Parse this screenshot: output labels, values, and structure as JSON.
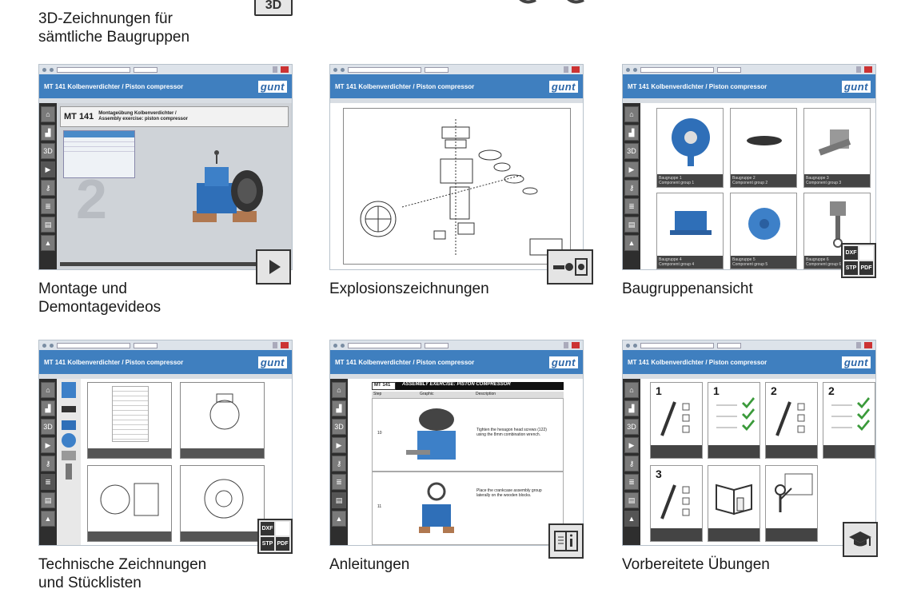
{
  "top": {
    "caption_line1": "3D-Zeichnungen für",
    "caption_line2": "sämtliche Baugruppen",
    "badge_label": "3D"
  },
  "app": {
    "title": "MT 141 Kolbenverdichter / Piston compressor",
    "logo": "gunt"
  },
  "sidebar_icons": [
    "home-icon",
    "compressor-icon",
    "3d-icon",
    "play-icon",
    "key-icon",
    "document-icon",
    "document-info-icon",
    "graduation-cap-icon"
  ],
  "sidebar_3d_label": "3D",
  "tiles": [
    {
      "caption_line1": "Montage und",
      "caption_line2": "Demontagevideos",
      "badge": "play-icon"
    },
    {
      "caption_line1": "Explosionszeichnungen",
      "caption_line2": "",
      "badge": "exploded-view-icon"
    },
    {
      "caption_line1": "Baugruppenansicht",
      "caption_line2": "",
      "badge": "file-format-icon"
    },
    {
      "caption_line1": "Technische Zeichnungen",
      "caption_line2": "und Stücklisten",
      "badge": "file-format-icon"
    },
    {
      "caption_line1": "Anleitungen",
      "caption_line2": "",
      "badge": "manual-icon"
    },
    {
      "caption_line1": "Vorbereitete Übungen",
      "caption_line2": "",
      "badge": "graduation-cap-icon"
    }
  ],
  "video": {
    "title_line1": "Montageübung Kolbenverdichter /",
    "title_line2": "Assembly exercise: piston compressor",
    "code": "MT 141",
    "big_number": "2"
  },
  "formats": {
    "dxf": "DXF",
    "stp": "STP",
    "pdf": "PDF"
  },
  "assembly_groups": [
    {
      "de": "Baugruppe 1",
      "en": "Component group 1"
    },
    {
      "de": "Baugruppe 2",
      "en": "Component group 2"
    },
    {
      "de": "Baugruppe 3",
      "en": "Component group 3"
    },
    {
      "de": "Baugruppe 4",
      "en": "Component group 4"
    },
    {
      "de": "Baugruppe 5",
      "en": "Component group 5"
    },
    {
      "de": "Baugruppe 6",
      "en": "Component group 6"
    }
  ],
  "manual": {
    "code": "MT 141",
    "title": "ASSEMBLY EXERCISE: PISTON COMPRESSOR",
    "col_step": "Step",
    "col_graphic": "Graphic",
    "col_description": "Description",
    "step1": "10",
    "step2": "11",
    "desc1": "Tighten the hexagon head screws (122) using the 8mm combination wrench.",
    "desc2": "Place the crankcase assembly group laterally on the wooden blocks."
  },
  "exercises": {
    "n1": "1",
    "n2": "2",
    "n3": "3"
  }
}
